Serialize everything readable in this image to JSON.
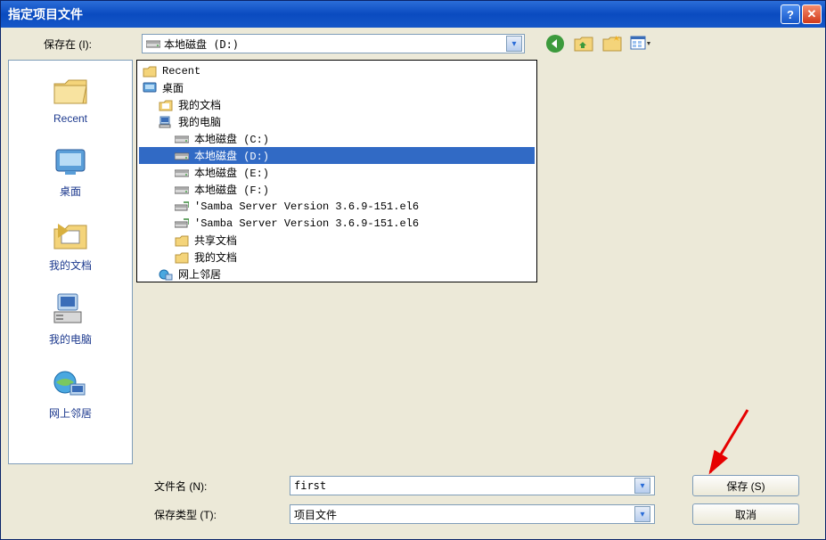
{
  "window": {
    "title": "指定项目文件"
  },
  "toolbar": {
    "save_in_label": "保存在 (I):",
    "location": "本地磁盘 (D:)"
  },
  "sidebar": {
    "items": [
      {
        "label": "Recent"
      },
      {
        "label": "桌面"
      },
      {
        "label": "我的文档"
      },
      {
        "label": "我的电脑"
      },
      {
        "label": "网上邻居"
      }
    ]
  },
  "tree": {
    "rows": [
      {
        "label": "Recent",
        "indent": 0,
        "icon": "folder",
        "selected": false
      },
      {
        "label": "桌面",
        "indent": 0,
        "icon": "desktop",
        "selected": false
      },
      {
        "label": "我的文档",
        "indent": 1,
        "icon": "mydocs",
        "selected": false
      },
      {
        "label": "我的电脑",
        "indent": 1,
        "icon": "mycomp",
        "selected": false
      },
      {
        "label": "本地磁盘 (C:)",
        "indent": 2,
        "icon": "drive",
        "selected": false
      },
      {
        "label": "本地磁盘 (D:)",
        "indent": 2,
        "icon": "drive",
        "selected": true
      },
      {
        "label": "本地磁盘 (E:)",
        "indent": 2,
        "icon": "drive",
        "selected": false
      },
      {
        "label": "本地磁盘 (F:)",
        "indent": 2,
        "icon": "drive",
        "selected": false
      },
      {
        "label": "'Samba Server Version 3.6.9-151.el6",
        "indent": 2,
        "icon": "netdrive",
        "selected": false
      },
      {
        "label": "'Samba Server Version 3.6.9-151.el6",
        "indent": 2,
        "icon": "netdrive",
        "selected": false
      },
      {
        "label": "共享文档",
        "indent": 2,
        "icon": "folder",
        "selected": false
      },
      {
        "label": "我的文档",
        "indent": 2,
        "icon": "folder",
        "selected": false
      },
      {
        "label": "网上邻居",
        "indent": 1,
        "icon": "network",
        "selected": false
      }
    ]
  },
  "fields": {
    "filename_label": "文件名 (N):",
    "filename_value": "first",
    "filetype_label": "保存类型 (T):",
    "filetype_value": "项目文件"
  },
  "buttons": {
    "save": "保存 (S)",
    "cancel": "取消"
  }
}
